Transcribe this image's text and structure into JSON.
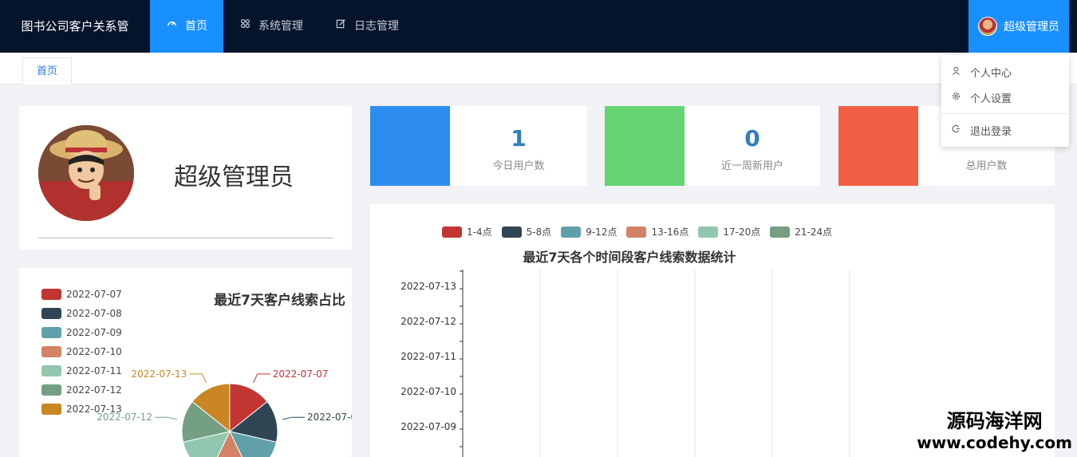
{
  "app": {
    "title": "图书公司客户关系管"
  },
  "nav": {
    "items": [
      {
        "label": "首页",
        "icon": "dashboard-icon",
        "active": true
      },
      {
        "label": "系统管理",
        "icon": "grid-icon",
        "active": false
      },
      {
        "label": "日志管理",
        "icon": "edit-icon",
        "active": false
      }
    ]
  },
  "user": {
    "name": "超级管理员"
  },
  "user_menu": {
    "items": [
      {
        "label": "个人中心",
        "icon": "user-icon"
      },
      {
        "label": "个人设置",
        "icon": "gear-icon"
      },
      {
        "label": "退出登录",
        "icon": "logout-icon"
      }
    ]
  },
  "tabs": [
    {
      "label": "首页"
    }
  ],
  "profile": {
    "name": "超级管理员"
  },
  "stats": [
    {
      "value": "1",
      "label": "今日用户数",
      "color": "#2d8cf0"
    },
    {
      "value": "0",
      "label": "近一周新用户",
      "color": "#64d572"
    },
    {
      "value": "",
      "label": "总用户数",
      "color": "#f25e43"
    }
  ],
  "watermark": {
    "line1": "源码海洋网",
    "line2": "www.codehy.com"
  },
  "chart_data": [
    {
      "type": "pie",
      "title": "最近7天客户线索占比",
      "categories": [
        "2022-07-07",
        "2022-07-08",
        "2022-07-09",
        "2022-07-10",
        "2022-07-11",
        "2022-07-12",
        "2022-07-13"
      ],
      "colors": [
        "#c23531",
        "#2f4554",
        "#61a0a8",
        "#d48265",
        "#91c7ae",
        "#749f83",
        "#ca8622"
      ],
      "values": [
        1,
        1,
        1,
        1,
        1,
        1,
        1
      ],
      "legend": "left"
    },
    {
      "type": "bar",
      "title": "最近7天各个时间段客户线索数据统计",
      "series": [
        {
          "name": "1-4点",
          "color": "#c23531"
        },
        {
          "name": "5-8点",
          "color": "#2f4554"
        },
        {
          "name": "9-12点",
          "color": "#61a0a8"
        },
        {
          "name": "13-16点",
          "color": "#d48265"
        },
        {
          "name": "17-20点",
          "color": "#91c7ae"
        },
        {
          "name": "21-24点",
          "color": "#749f83"
        }
      ],
      "categories": [
        "2022-07-13",
        "2022-07-12",
        "2022-07-11",
        "2022-07-10",
        "2022-07-09"
      ],
      "legend": "top",
      "grid": true
    }
  ]
}
